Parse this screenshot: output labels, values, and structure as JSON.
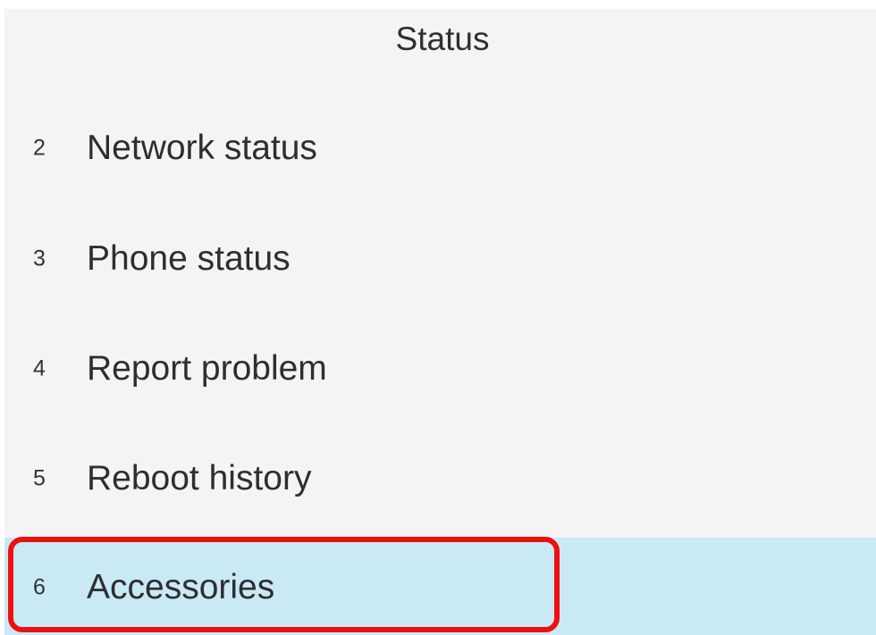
{
  "screen": {
    "title": "Status"
  },
  "menu": {
    "items": [
      {
        "number": "2",
        "label": "Network status"
      },
      {
        "number": "3",
        "label": "Phone status"
      },
      {
        "number": "4",
        "label": "Report problem"
      },
      {
        "number": "5",
        "label": "Reboot history"
      },
      {
        "number": "6",
        "label": "Accessories"
      }
    ],
    "selected_label": "Accessories"
  },
  "colors": {
    "background": "#f4f4f4",
    "selected_row": "#c9e9f6",
    "highlight_outline": "#ee1010",
    "text": "#2e2e2e"
  }
}
